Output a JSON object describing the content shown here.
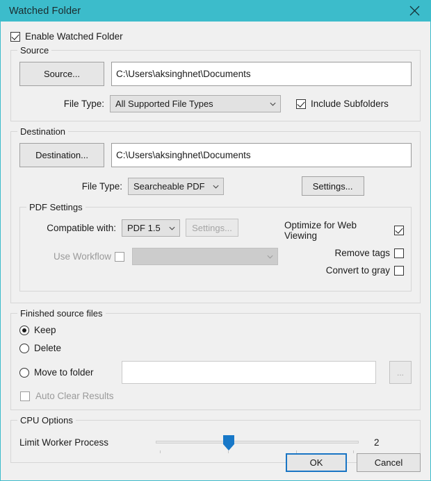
{
  "window": {
    "title": "Watched Folder",
    "close_icon": "close-icon",
    "accent_color": "#3cbccb",
    "background_color": "#f0f0f0"
  },
  "enable": {
    "label": "Enable Watched Folder",
    "checked": true
  },
  "source": {
    "legend": "Source",
    "browse_button": "Source...",
    "path_value": "C:\\Users\\aksinghnet\\Documents",
    "file_type_label": "File Type:",
    "file_type_value": "All Supported File Types",
    "include_subfolders_label": "Include Subfolders",
    "include_subfolders_checked": true
  },
  "destination": {
    "legend": "Destination",
    "browse_button": "Destination...",
    "path_value": "C:\\Users\\aksinghnet\\Documents",
    "file_type_label": "File Type:",
    "file_type_value": "Searcheable PDF",
    "settings_button": "Settings..."
  },
  "pdf_settings": {
    "legend": "PDF Settings",
    "compatible_label": "Compatible with:",
    "compatible_value": "PDF 1.5",
    "compatible_settings_button": "Settings...",
    "use_workflow_label": "Use Workflow",
    "use_workflow_checked": false,
    "workflow_value": "",
    "optimize_label": "Optimize for Web Viewing",
    "optimize_checked": true,
    "remove_tags_label": "Remove tags",
    "remove_tags_checked": false,
    "convert_gray_label": "Convert to gray",
    "convert_gray_checked": false
  },
  "finished_files": {
    "legend": "Finished source files",
    "options": [
      {
        "label": "Keep",
        "selected": true
      },
      {
        "label": "Delete",
        "selected": false
      },
      {
        "label": "Move to folder",
        "selected": false
      }
    ],
    "move_path_value": "",
    "browse_button": "...",
    "auto_clear_label": "Auto Clear Results",
    "auto_clear_checked": false
  },
  "cpu_options": {
    "legend": "CPU Options",
    "slider_label": "Limit Worker Process",
    "value": "2",
    "min": 1,
    "max": 8
  },
  "footer": {
    "ok_label": "OK",
    "cancel_label": "Cancel"
  }
}
